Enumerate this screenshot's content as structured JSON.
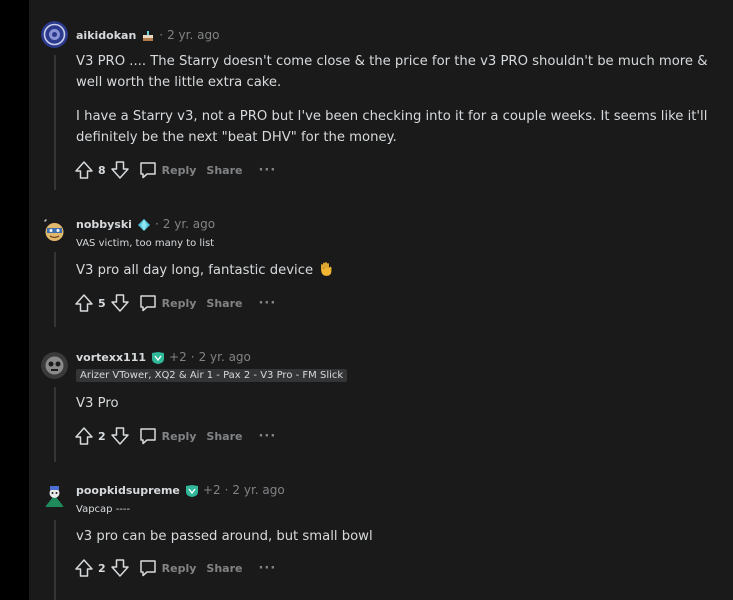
{
  "comments": [
    {
      "username": "aikidokan",
      "plus": "",
      "time": "2 yr. ago",
      "flair": "",
      "paragraphs": [
        "V3 PRO .... The Starry doesn't come close & the price for the v3 PRO shouldn't be much more & well worth the little extra cake.",
        "I have a Starry v3, not a PRO but I've been checking into it for a couple weeks. It seems like it'll definitely be the next \"beat DHV\" for the money."
      ],
      "votes": "8"
    },
    {
      "username": "nobbyski",
      "plus": "",
      "time": "2 yr. ago",
      "flair": "VAS victim, too many to list",
      "paragraphs": [
        "V3 pro all day long, fantastic device"
      ],
      "votes": "5"
    },
    {
      "username": "vortexx111",
      "plus": "+2",
      "time": "2 yr. ago",
      "flair": "Arizer VTower, XQ2 & Air 1 - Pax 2 - V3 Pro - FM Slick",
      "paragraphs": [
        "V3 Pro"
      ],
      "votes": "2"
    },
    {
      "username": "poopkidsupreme",
      "plus": "+2",
      "time": "2 yr. ago",
      "flair": "Vapcap ----",
      "paragraphs": [
        "v3 pro can be passed around, but small bowl"
      ],
      "votes": "2"
    }
  ],
  "labels": {
    "sep": "·",
    "reply": "Reply",
    "share": "Share",
    "more": "···"
  }
}
